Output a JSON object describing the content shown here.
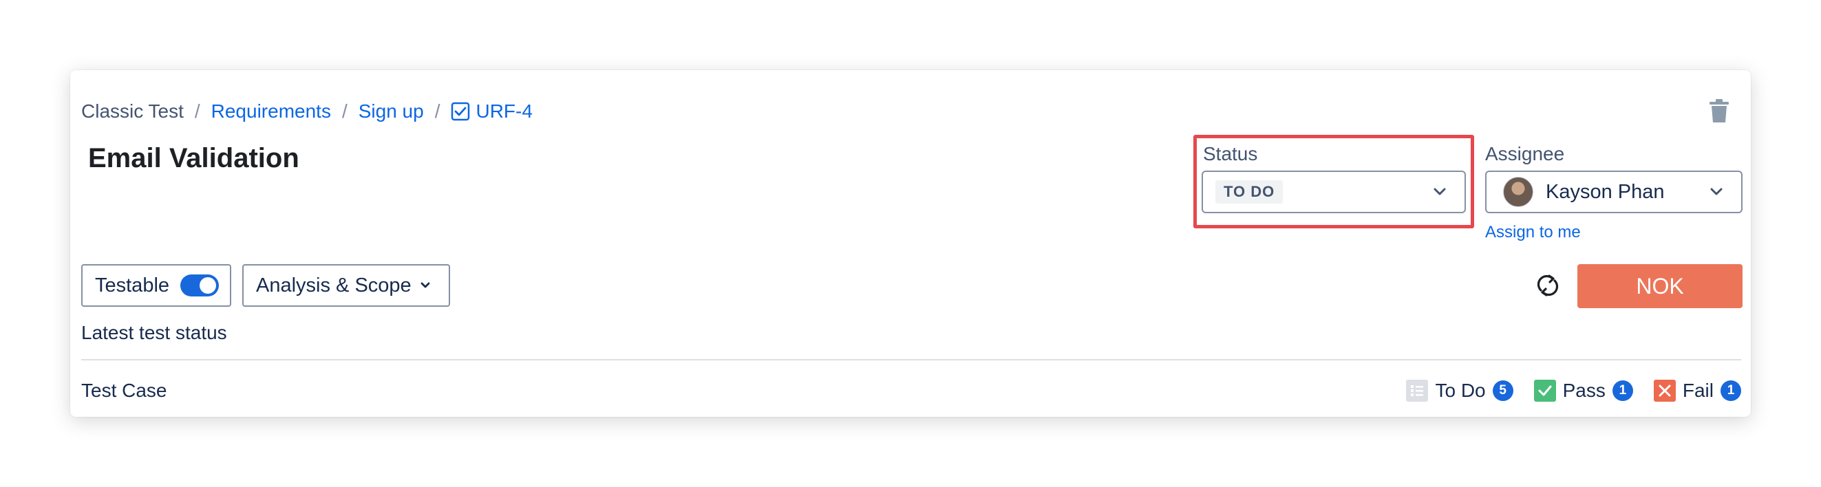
{
  "breadcrumb": {
    "project": "Classic Test",
    "requirements": "Requirements",
    "parent": "Sign up",
    "issue_key": "URF-4"
  },
  "issue": {
    "title": "Email Validation"
  },
  "status": {
    "label": "Status",
    "value": "TO DO"
  },
  "assignee": {
    "label": "Assignee",
    "name": "Kayson Phan",
    "assign_to_me": "Assign to me"
  },
  "toolbar": {
    "testable_label": "Testable",
    "testable_on": true,
    "analysis_label": "Analysis & Scope",
    "result_label": "NOK"
  },
  "test_status": {
    "heading": "Latest test status",
    "row_label": "Test Case",
    "todo": {
      "label": "To Do",
      "count": "5"
    },
    "pass": {
      "label": "Pass",
      "count": "1"
    },
    "fail": {
      "label": "Fail",
      "count": "1"
    }
  },
  "colors": {
    "accent": "#1868db",
    "link": "#0c66e4",
    "nok": "#ec7559",
    "pass": "#4bbd7a",
    "fail": "#ed6a4e",
    "highlight": "#e5484d"
  },
  "icons": [
    "issue-checkbox-icon",
    "trash-icon",
    "chevron-down-icon",
    "refresh-icon",
    "todo-list-icon",
    "pass-check-icon",
    "fail-x-icon"
  ]
}
